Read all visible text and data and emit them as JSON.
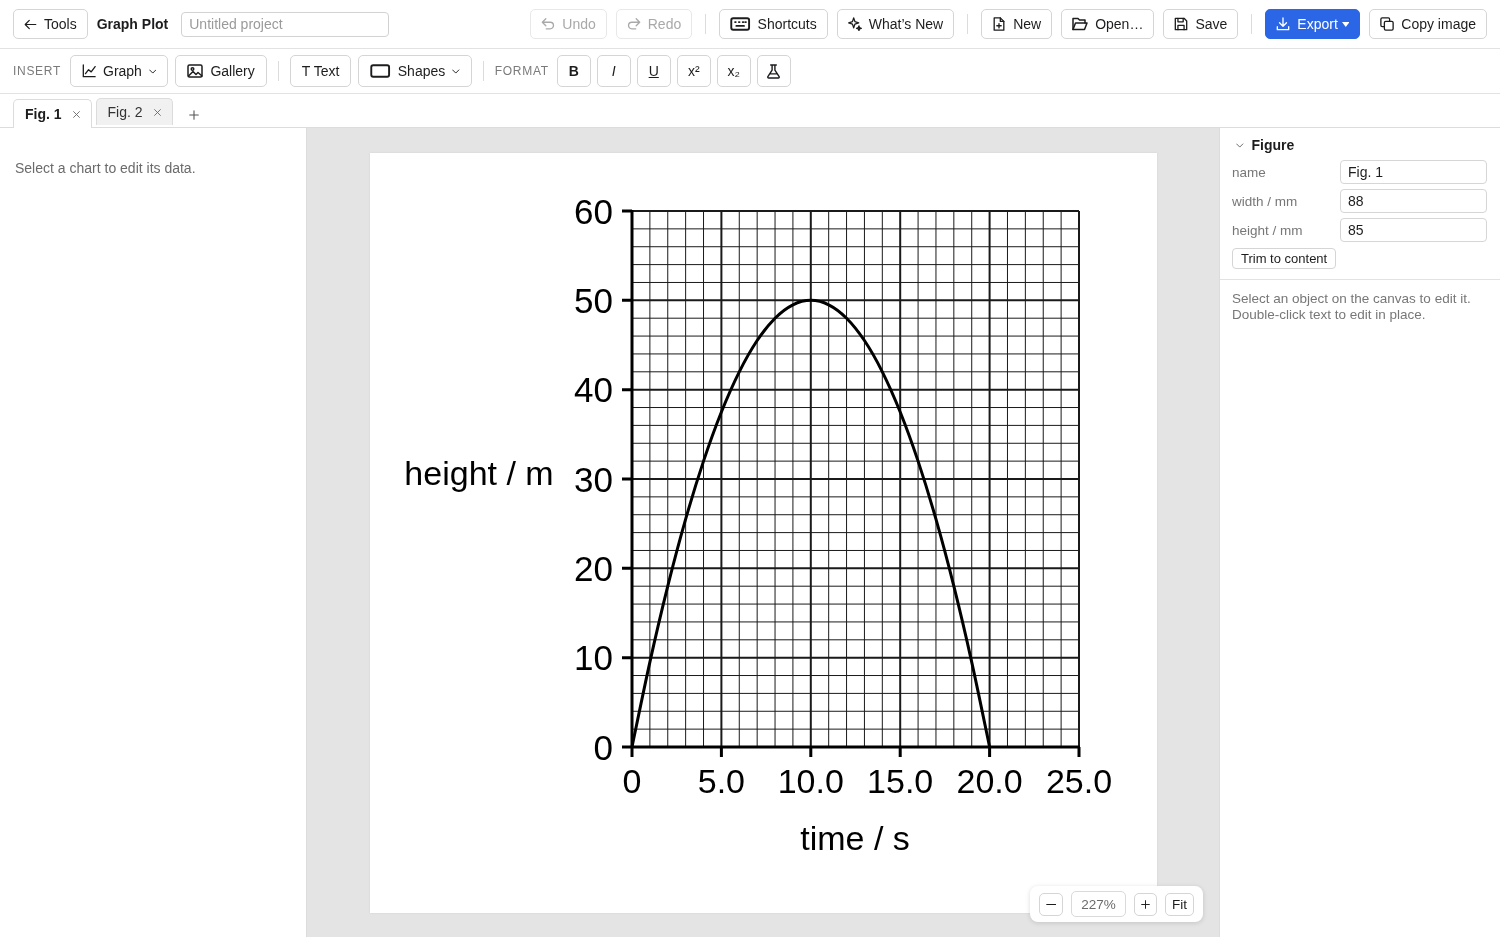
{
  "toolbar": {
    "back_button": "Tools",
    "app_title": "Graph Plot",
    "project_name": {
      "placeholder": "Untitled project"
    },
    "button_groups": [
      [
        {
          "kind": "undo",
          "label": "Undo",
          "disabled": true,
          "primary": false,
          "dropdown": false
        },
        {
          "kind": "redo",
          "label": "Redo",
          "disabled": true,
          "primary": false,
          "dropdown": false
        }
      ],
      [
        {
          "kind": "shortcuts",
          "label": "Shortcuts",
          "disabled": false,
          "primary": false,
          "dropdown": false
        },
        {
          "kind": "whats-new",
          "label": "What’s New",
          "disabled": false,
          "primary": false,
          "dropdown": false
        }
      ],
      [
        {
          "kind": "new",
          "label": "New",
          "disabled": false,
          "primary": false,
          "dropdown": false
        },
        {
          "kind": "open",
          "label": "Open…",
          "disabled": false,
          "primary": false,
          "dropdown": false
        },
        {
          "kind": "save",
          "label": "Save",
          "disabled": false,
          "primary": false,
          "dropdown": false
        }
      ],
      [
        {
          "kind": "export",
          "label": "Export",
          "disabled": false,
          "primary": true,
          "dropdown": true
        },
        {
          "kind": "copy",
          "label": "Copy image",
          "disabled": false,
          "primary": false,
          "dropdown": false
        }
      ]
    ]
  },
  "insert_bar": {
    "insert_label": "INSERT",
    "insert_groups": [
      [
        {
          "kind": "graph",
          "label": "Graph",
          "dropdown": true
        },
        {
          "kind": "gallery",
          "label": "Gallery",
          "dropdown": false
        }
      ],
      [
        {
          "kind": "text",
          "label": "T Text",
          "dropdown": false
        },
        {
          "kind": "shapes",
          "label": "Shapes",
          "dropdown": true
        }
      ]
    ],
    "format_label": "FORMAT",
    "format_buttons": [
      {
        "kind": "bold",
        "label": "B"
      },
      {
        "kind": "italic",
        "label": "I"
      },
      {
        "kind": "underline",
        "label": "U"
      },
      {
        "kind": "superscript",
        "label": "x²"
      },
      {
        "kind": "subscript",
        "label": "x₂"
      },
      {
        "kind": "flask"
      }
    ]
  },
  "tabs": [
    {
      "label": "Fig. 1",
      "selected": true
    },
    {
      "label": "Fig. 2",
      "selected": false
    }
  ],
  "data_panel": {
    "hint": "Select a chart to edit its data."
  },
  "canvas": {
    "chart_data": {
      "type": "line",
      "xlabel": "time / s",
      "ylabel": "height / m",
      "x": [
        0,
        1,
        2,
        3,
        4,
        5,
        6,
        7,
        8,
        9,
        10,
        11,
        12,
        13,
        14,
        15,
        16,
        17,
        18,
        19,
        20
      ],
      "series": [
        {
          "color": "#000000",
          "values": [
            0,
            9.5,
            18,
            25.5,
            32,
            37.5,
            42,
            45.5,
            48,
            49.5,
            50,
            49.5,
            48,
            45.5,
            42,
            37.5,
            32,
            25.5,
            18,
            9.5,
            0
          ]
        }
      ],
      "xlim": [
        0,
        25
      ],
      "ylim": [
        0,
        60
      ],
      "xticks": [
        {
          "value": 0,
          "label": "0"
        },
        {
          "value": 5,
          "label": "5.0"
        },
        {
          "value": 10,
          "label": "10.0"
        },
        {
          "value": 15,
          "label": "15.0"
        },
        {
          "value": 20,
          "label": "20.0"
        },
        {
          "value": 25,
          "label": "25.0"
        }
      ],
      "yticks": [
        0,
        10,
        20,
        30,
        40,
        50,
        60
      ],
      "grid": true
    },
    "zoom": {
      "zoom_text": "227%",
      "fit_button": "Fit"
    }
  },
  "inspector": {
    "section": {
      "title": "Figure",
      "expanded": true,
      "fields": [
        {
          "label": "name",
          "value": "Fig. 1"
        },
        {
          "label": "width / mm",
          "value": "88"
        },
        {
          "label": "height / mm",
          "value": "85"
        }
      ],
      "button": "Trim to content"
    },
    "help_lines": [
      "Select an object on the canvas to edit it.",
      "Double-click text to edit in place."
    ]
  }
}
